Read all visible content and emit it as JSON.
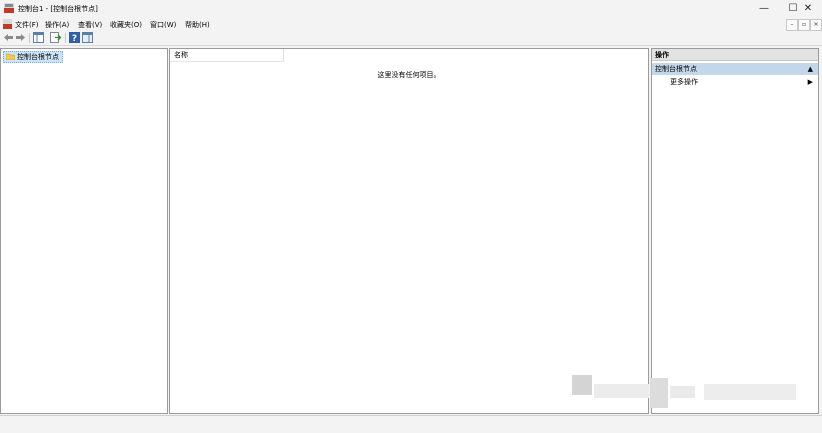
{
  "window": {
    "title": "控制台1 - [控制台根节点]",
    "buttons": {
      "minimize": "—",
      "maximize": "☐",
      "close": "✕"
    }
  },
  "menubar": {
    "items": [
      "文件(F)",
      "操作(A)",
      "查看(V)",
      "收藏夹(O)",
      "窗口(W)",
      "帮助(H)"
    ],
    "mdi_buttons": {
      "minimize": "–",
      "restore": "▫",
      "close": "×"
    }
  },
  "toolbar": {
    "icons": [
      "back-arrow-icon",
      "forward-arrow-icon",
      "show-hide-tree-icon",
      "export-list-icon",
      "help-icon",
      "show-hide-action-pane-icon"
    ]
  },
  "tree": {
    "root_label": "控制台根节点"
  },
  "center": {
    "column_header": "名称",
    "empty_message": "这里没有任何项目。"
  },
  "actions": {
    "header": "操作",
    "section_title": "控制台根节点",
    "items": [
      {
        "label": "更多操作"
      }
    ]
  },
  "colors": {
    "selection": "#cce4f7",
    "section_bg": "#c3d7ea",
    "window_bg": "#f3f3f3"
  }
}
